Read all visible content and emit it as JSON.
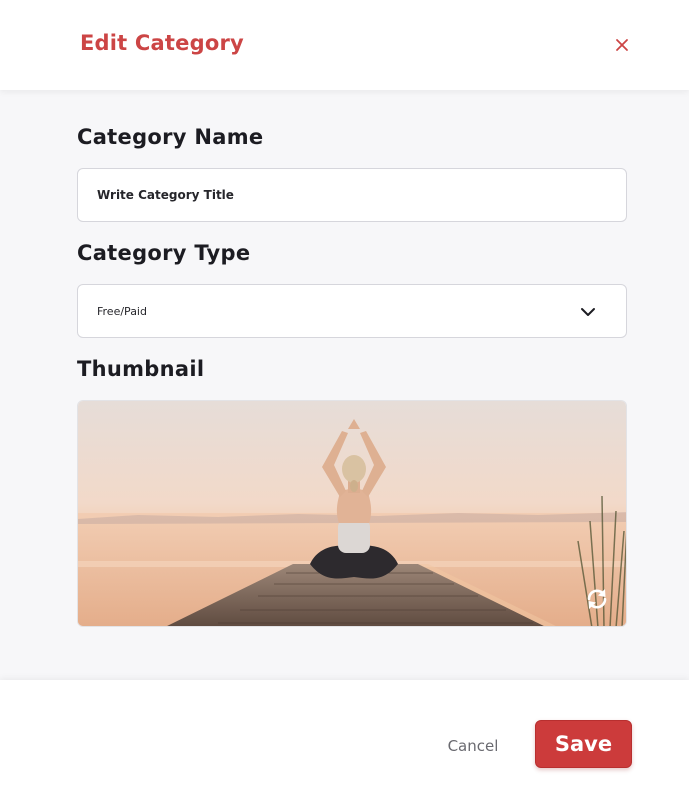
{
  "header": {
    "title": "Edit Category",
    "close_icon": "close-icon"
  },
  "form": {
    "name_label": "Category Name",
    "name_value": "Write Category Title",
    "type_label": "Category Type",
    "type_value": "Free/Paid",
    "thumbnail_label": "Thumbnail",
    "thumbnail_image": "woman-yoga-on-pier-image",
    "refresh_icon": "refresh-icon"
  },
  "footer": {
    "cancel_label": "Cancel",
    "save_label": "Save"
  },
  "colors": {
    "accent": "#cc4545",
    "save_bg": "#cc3b3b",
    "body_bg": "#f7f7f9"
  }
}
